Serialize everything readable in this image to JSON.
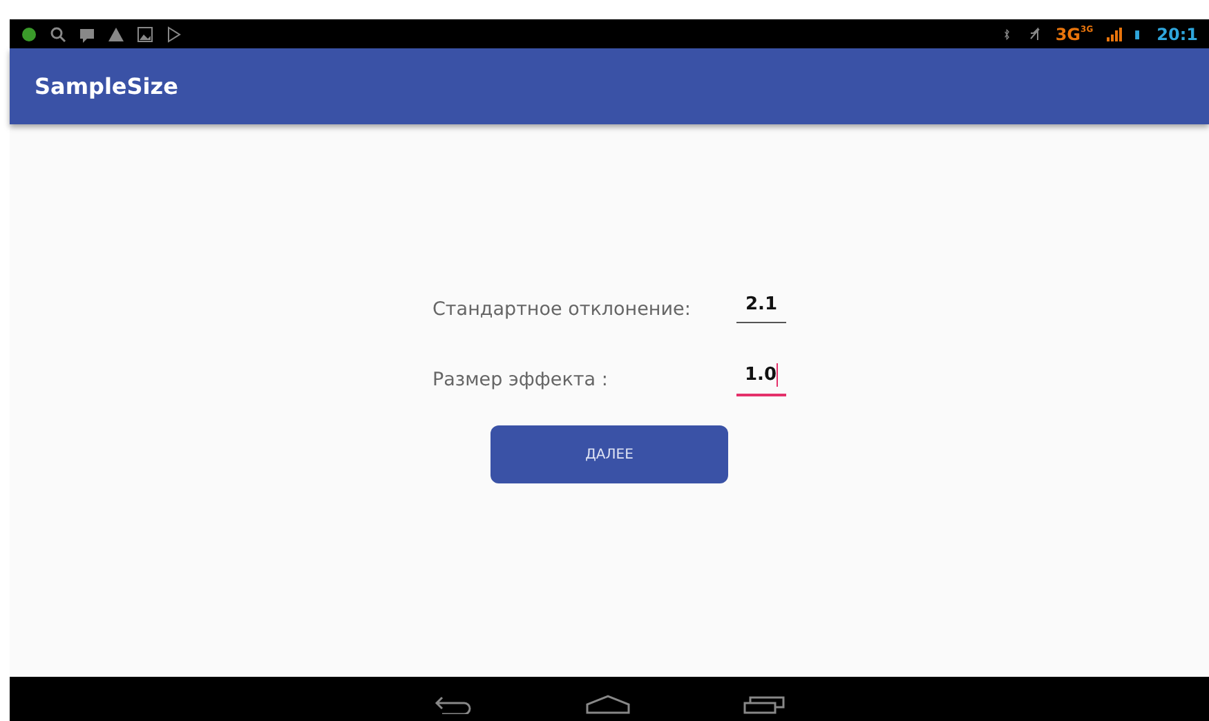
{
  "status_bar": {
    "network": "3G",
    "network_small": "3G",
    "time": "20:1"
  },
  "app_bar": {
    "title": "SampleSize"
  },
  "form": {
    "fields": [
      {
        "label": "Стандартное отклонение:",
        "value": "2.1",
        "focused": false
      },
      {
        "label": "Размер эффекта :",
        "value": "1.0",
        "focused": true
      }
    ],
    "button": "ДАЛЕЕ"
  }
}
